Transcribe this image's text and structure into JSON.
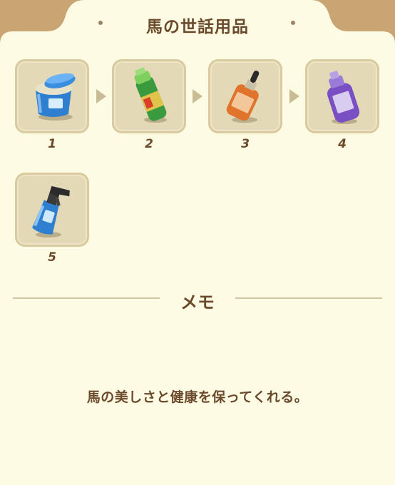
{
  "title": "馬の世話用品",
  "items": [
    {
      "number": "1",
      "icon": "grooming-jar-icon"
    },
    {
      "number": "2",
      "icon": "spray-can-icon"
    },
    {
      "number": "3",
      "icon": "dropper-bottle-icon"
    },
    {
      "number": "4",
      "icon": "shampoo-bottle-icon"
    },
    {
      "number": "5",
      "icon": "trigger-spray-bottle-icon"
    }
  ],
  "memo": {
    "label": "メモ",
    "description": "馬の美しさと健康を保ってくれる。"
  },
  "colors": {
    "frame": "#c9a574",
    "panel": "#fdfbe4",
    "slot": "#e4d9b6",
    "text": "#6b4a2c"
  }
}
